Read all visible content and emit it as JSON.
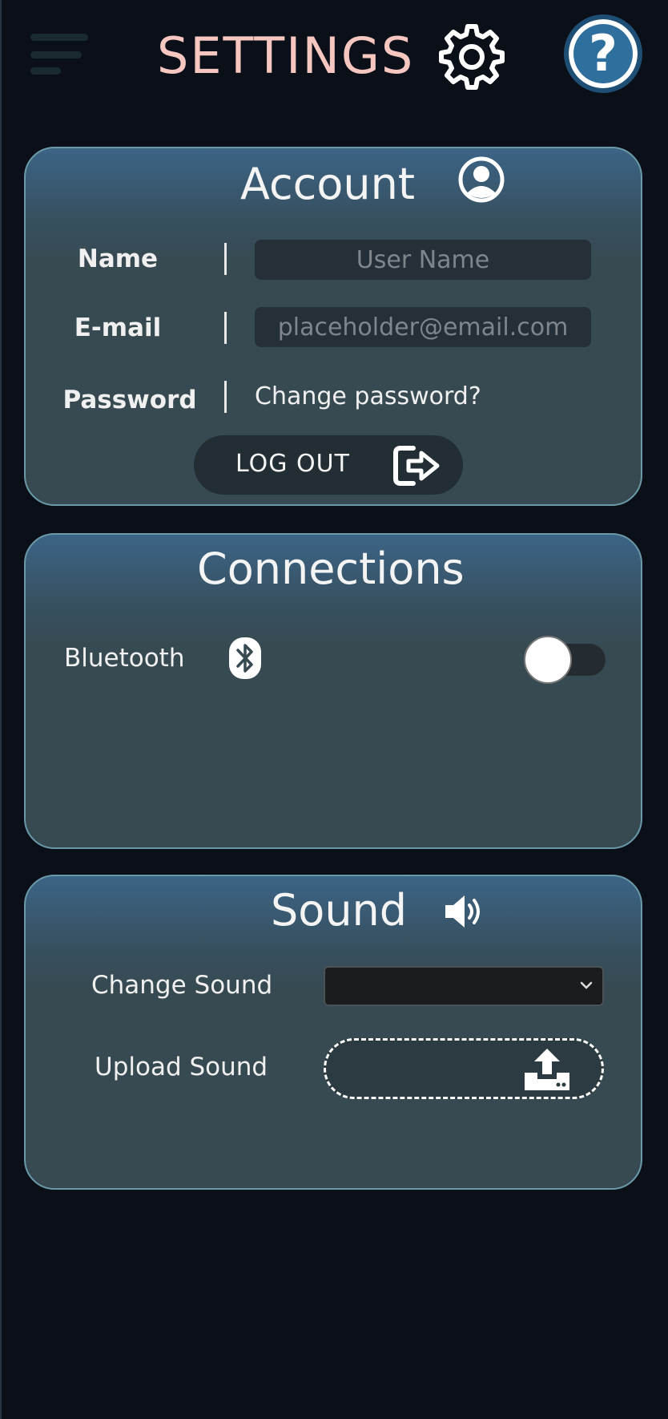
{
  "header": {
    "title": "SETTINGS",
    "menu_icon": "hamburger-icon",
    "settings_icon": "gear-icon",
    "help_label": "?"
  },
  "account": {
    "title": "Account",
    "icon": "user-circle-icon",
    "name_label": "Name",
    "name_placeholder": "User Name",
    "name_value": "",
    "email_label": "E-mail",
    "email_placeholder": "placeholder@email.com",
    "email_value": "",
    "password_label": "Password",
    "change_password_link": "Change password?",
    "logout_label": "LOG OUT",
    "logout_icon": "sign-out-icon"
  },
  "connections": {
    "title": "Connections",
    "bluetooth_label": "Bluetooth",
    "bluetooth_icon": "bluetooth-icon",
    "bluetooth_enabled": false
  },
  "sound": {
    "title": "Sound",
    "icon": "speaker-icon",
    "change_sound_label": "Change Sound",
    "change_sound_value": "",
    "upload_sound_label": "Upload Sound",
    "upload_icon": "upload-icon"
  },
  "colors": {
    "background": "#0a0f18",
    "title": "#f6c6c0",
    "card_border": "#6a9aaa",
    "card_top": "#3c6486",
    "card_body": "#374a52",
    "help_blue": "#2e6f9e"
  }
}
